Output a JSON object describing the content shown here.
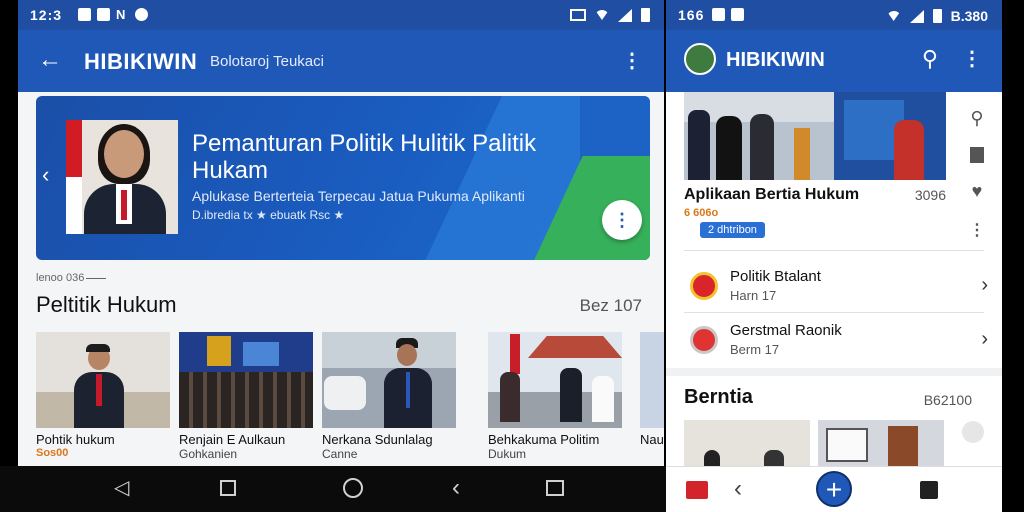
{
  "left_phone": {
    "status": {
      "time": "12:3",
      "icons": [
        "image-icon",
        "message-icon",
        "n-icon",
        "bell-icon"
      ]
    },
    "appbar": {
      "title": "HIBIKIWIN",
      "subtitle": "Bolotaroj Teukaci"
    },
    "hero": {
      "title": "Pemanturan Politik Hulitik Palitik Hukam",
      "description": "Aplukase Berterteia Terpecau Jatua Pukuma Aplikanti",
      "meta": "D.ibredia tx ★ ebuatk Rsc ★"
    },
    "caption": "lenoo 036",
    "section": {
      "title": "Peltitik Hukum",
      "count": "Bez 107"
    },
    "cards": [
      {
        "title": "Pohtik hukum",
        "sub": "Sos00",
        "sub_style": "orange"
      },
      {
        "title": "Renjain E Aulkaun",
        "sub": "Gohkanien",
        "sub_style": "gray"
      },
      {
        "title": "Nerkana Sdunlalag",
        "sub": "Canne",
        "sub_style": "gray"
      },
      {
        "title": "Behkakuma Politim",
        "sub": "Dukum",
        "sub_style": "gray"
      },
      {
        "title": "Nau",
        "sub": "",
        "sub_style": "gray"
      }
    ]
  },
  "right_phone": {
    "status": {
      "time": "166",
      "battery_text": "B.380"
    },
    "appbar": {
      "title": "HIBIKIWIN"
    },
    "featured": {
      "title": "Aplikaan Bertia Hukum",
      "count": "3096",
      "meta": "6 606o",
      "badge": "2 dhtribon"
    },
    "items": [
      {
        "title": "Politik Btalant",
        "sub": "Harn 17"
      },
      {
        "title": "Gerstmal Raonik",
        "sub": "Berm 17"
      }
    ],
    "section": {
      "title": "Berntia",
      "count": "B62100"
    }
  },
  "colors": {
    "primary": "#2058b8",
    "status": "#1f4ea3",
    "accent_orange": "#d9781a",
    "accent_green": "#36b05a"
  }
}
